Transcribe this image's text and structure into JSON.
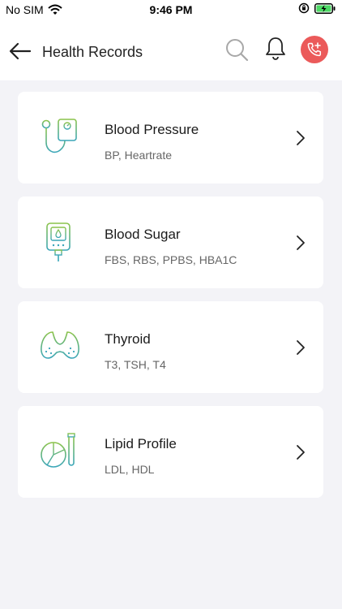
{
  "status": {
    "carrier": "No SIM",
    "time": "9:46 PM"
  },
  "header": {
    "title": "Health Records"
  },
  "colors": {
    "accent": "#eb5a5a",
    "icon_green": "#8bc34a",
    "icon_teal": "#3aa6b9"
  },
  "records": [
    {
      "title": "Blood Pressure",
      "subtitle": "BP, Heartrate",
      "icon": "blood-pressure-icon"
    },
    {
      "title": "Blood Sugar",
      "subtitle": "FBS, RBS, PPBS, HBA1C",
      "icon": "glucometer-icon"
    },
    {
      "title": "Thyroid",
      "subtitle": "T3, TSH, T4",
      "icon": "thyroid-icon"
    },
    {
      "title": "Lipid Profile",
      "subtitle": "LDL, HDL",
      "icon": "lipid-profile-icon"
    }
  ]
}
